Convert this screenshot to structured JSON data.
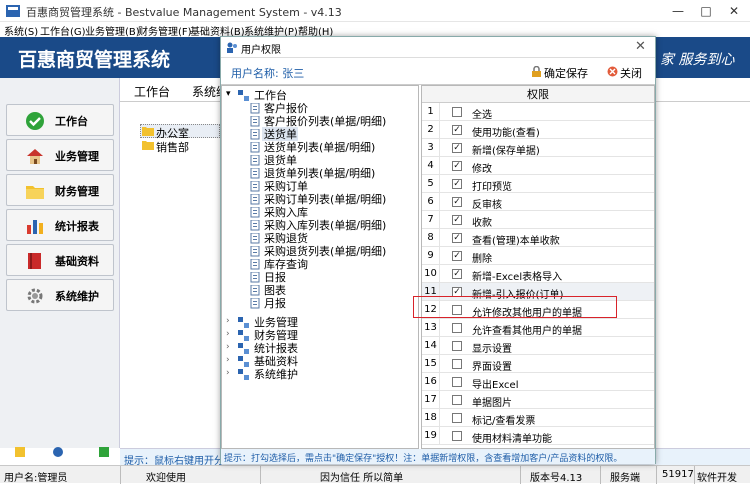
{
  "window": {
    "title": "百惠商贸管理系统 - Bestvalue Management System - v4.13"
  },
  "menu": [
    "系统(S)",
    "工作台(G)",
    "业务管理(B)",
    "财务管理(F)",
    "基础资料(B)",
    "系统维护(P)",
    "帮助(H)"
  ],
  "banner": {
    "name": "百惠商贸管理系统",
    "slogan": "家 服务到心"
  },
  "sidebar": [
    {
      "label": "工作台",
      "icon": "check-circle-icon"
    },
    {
      "label": "业务管理",
      "icon": "house-icon"
    },
    {
      "label": "财务管理",
      "icon": "folder-icon"
    },
    {
      "label": "统计报表",
      "icon": "bar-chart-icon"
    },
    {
      "label": "基础资料",
      "icon": "book-icon"
    },
    {
      "label": "系统维护",
      "icon": "gear-icon"
    }
  ],
  "main_tabs": [
    "工作台",
    "系统维"
  ],
  "departments": [
    "办公室",
    "销售部"
  ],
  "main_hint": "提示：鼠标右键用开分",
  "dialog": {
    "title": "用户权限",
    "user_label": "用户名称: 张三",
    "save_label": "确定保存",
    "close_label": "关闭",
    "tree": {
      "root": "工作台",
      "children": [
        "客户报价",
        "客户报价列表(单据/明细)",
        "送货单",
        "送货单列表(单据/明细)",
        "退货单",
        "退货单列表(单据/明细)",
        "采购订单",
        "采购订单列表(单据/明细)",
        "采购入库",
        "采购入库列表(单据/明细)",
        "采购退货",
        "采购退货列表(单据/明细)",
        "库存查询",
        "日报",
        "图表",
        "月报"
      ],
      "others": [
        "业务管理",
        "财务管理",
        "统计报表",
        "基础资料",
        "系统维护"
      ]
    },
    "perm_header": "权限",
    "permissions": [
      {
        "n": "1",
        "label": "全选",
        "checked": false
      },
      {
        "n": "2",
        "label": "使用功能(查看)",
        "checked": true
      },
      {
        "n": "3",
        "label": "新增(保存单据)",
        "checked": true
      },
      {
        "n": "4",
        "label": "修改",
        "checked": true
      },
      {
        "n": "5",
        "label": "打印预览",
        "checked": true
      },
      {
        "n": "6",
        "label": "反审核",
        "checked": true
      },
      {
        "n": "7",
        "label": "收款",
        "checked": true
      },
      {
        "n": "8",
        "label": "查看(管理)本单收款",
        "checked": true
      },
      {
        "n": "9",
        "label": "删除",
        "checked": true
      },
      {
        "n": "10",
        "label": "新增-Excel表格导入",
        "checked": true
      },
      {
        "n": "11",
        "label": "新增-引入报价(订单)",
        "checked": true
      },
      {
        "n": "12",
        "label": "允许修改其他用户的单据",
        "checked": false
      },
      {
        "n": "13",
        "label": "允许查看其他用户的单据",
        "checked": false
      },
      {
        "n": "14",
        "label": "显示设置",
        "checked": false
      },
      {
        "n": "15",
        "label": "界面设置",
        "checked": false
      },
      {
        "n": "16",
        "label": "导出Excel",
        "checked": false
      },
      {
        "n": "17",
        "label": "单据图片",
        "checked": false
      },
      {
        "n": "18",
        "label": "标记/查看发票",
        "checked": false
      },
      {
        "n": "19",
        "label": "使用材料清单功能",
        "checked": false
      }
    ],
    "hint": "提示：打勾选择后，需点击\"确定保存\"授权！注：单据新增权限，含查看增加客户/产品资料的权限。"
  },
  "status": {
    "user": "用户名:管理员",
    "welcome": "欢迎使用",
    "motto": "因为信任 所以简单",
    "version": "版本号4.13",
    "server": "服务端",
    "port": "51917",
    "software": "软件开发"
  },
  "colors": {
    "banner": "#1a4a88",
    "highlight": "#d8232a",
    "hint_text": "#1f5ea8"
  }
}
